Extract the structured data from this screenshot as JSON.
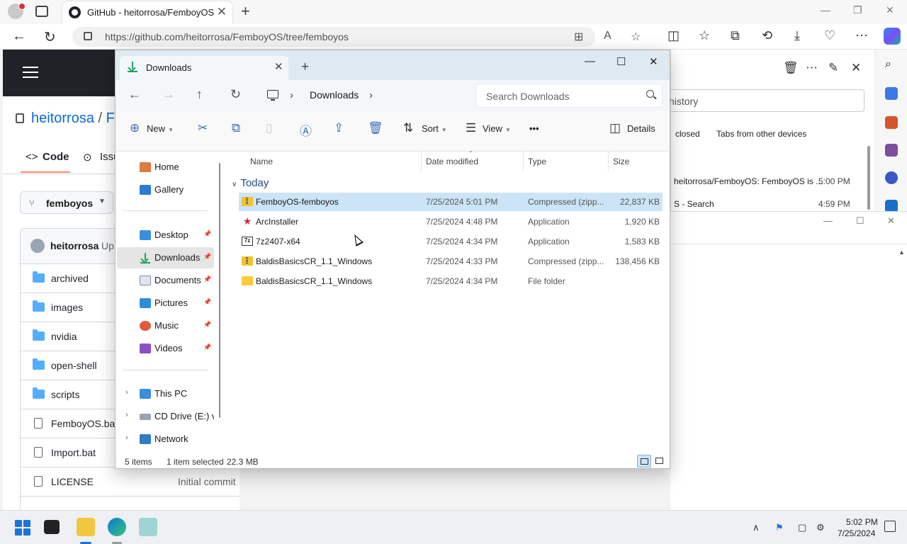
{
  "browser": {
    "tab_title": "GitHub - heitorrosa/FemboyOS: F",
    "url": "https://github.com/heitorrosa/FemboyOS/tree/femboyos"
  },
  "github": {
    "owner": "heitorrosa",
    "separator": "/",
    "repo_fragment": "F",
    "tab_code": "Code",
    "tab_issues": "Issu",
    "branch": "femboyos",
    "commit_user": "heitorrosa",
    "commit_up": "Up",
    "files": [
      {
        "name": "archived",
        "kind": "folder",
        "msg": ""
      },
      {
        "name": "images",
        "kind": "folder",
        "msg": ""
      },
      {
        "name": "nvidia",
        "kind": "folder",
        "msg": ""
      },
      {
        "name": "open-shell",
        "kind": "folder",
        "msg": ""
      },
      {
        "name": "scripts",
        "kind": "folder",
        "msg": ""
      },
      {
        "name": "FemboyOS.bat",
        "kind": "file",
        "msg": ""
      },
      {
        "name": "Import.bat",
        "kind": "file",
        "msg": ""
      },
      {
        "name": "LICENSE",
        "kind": "file",
        "msg": "Initial commit"
      }
    ]
  },
  "history": {
    "search_placeholder": "history",
    "tab_recent": "closed",
    "tab_other": "Tabs from other devices",
    "items": [
      {
        "title": "heitorrosa/FemboyOS: FemboyOS is ...",
        "time": "5:00 PM"
      },
      {
        "title": "S - Search",
        "time": "4:59 PM"
      }
    ]
  },
  "explorer": {
    "tab_label": "Downloads",
    "breadcrumb": "Downloads",
    "search_placeholder": "Search Downloads",
    "commands": {
      "new": "New",
      "sort": "Sort",
      "view": "View",
      "more": "•••",
      "details": "Details"
    },
    "sidebar": {
      "home": "Home",
      "gallery": "Gallery",
      "desktop": "Desktop",
      "downloads": "Downloads",
      "documents": "Documents",
      "pictures": "Pictures",
      "music": "Music",
      "videos": "Videos",
      "this_pc": "This PC",
      "cd_drive": "CD Drive (E:) virt",
      "network": "Network"
    },
    "columns": {
      "name": "Name",
      "date": "Date modified",
      "type": "Type",
      "size": "Size"
    },
    "group": "Today",
    "files": [
      {
        "name": "FemboyOS-femboyos",
        "date": "7/25/2024 5:01 PM",
        "type": "Compressed (zipp...",
        "size": "22,837 KB",
        "icon": "zip",
        "selected": true
      },
      {
        "name": "ArcInstaller",
        "date": "7/25/2024 4:48 PM",
        "type": "Application",
        "size": "1,920 KB",
        "icon": "star-app",
        "selected": false
      },
      {
        "name": "7z2407-x64",
        "date": "7/25/2024 4:34 PM",
        "type": "Application",
        "size": "1,583 KB",
        "icon": "7z-app",
        "selected": false
      },
      {
        "name": "BaldisBasicsCR_1.1_Windows",
        "date": "7/25/2024 4:33 PM",
        "type": "Compressed (zipp...",
        "size": "138,456 KB",
        "icon": "zip",
        "selected": false
      },
      {
        "name": "BaldisBasicsCR_1.1_Windows",
        "date": "7/25/2024 4:34 PM",
        "type": "File folder",
        "size": "",
        "icon": "folder",
        "selected": false
      }
    ],
    "status": {
      "items": "5 items",
      "selected": "1 item selected",
      "size": "22.3 MB"
    }
  },
  "taskbar": {
    "time": "5:02 PM",
    "date": "7/25/2024"
  },
  "colors": {
    "accent": "#1a73d9",
    "selection": "#cce4f7",
    "github_link": "#0969da",
    "github_header": "#1f2328"
  }
}
